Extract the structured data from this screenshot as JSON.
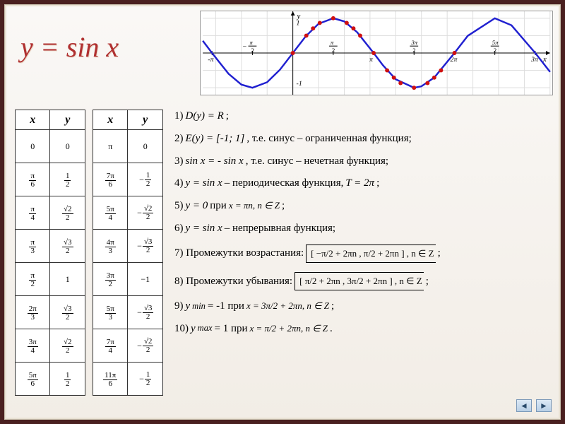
{
  "title": "y = sin x",
  "chart_data": {
    "type": "line",
    "title": "",
    "xlabel": "x",
    "ylabel": "y",
    "xlim": [
      -3.5,
      10
    ],
    "ylim": [
      -1.2,
      1.2
    ],
    "x_ticks": [
      {
        "value": -3.1416,
        "label": "-π"
      },
      {
        "value": -1.5708,
        "label": "−π/2"
      },
      {
        "value": 1.5708,
        "label": "π/2"
      },
      {
        "value": 3.1416,
        "label": "π"
      },
      {
        "value": 4.7124,
        "label": "3π/2"
      },
      {
        "value": 6.2832,
        "label": "2π"
      },
      {
        "value": 7.854,
        "label": "5π/2"
      },
      {
        "value": 9.4248,
        "label": "3π"
      }
    ],
    "y_ticks": [
      {
        "value": 1,
        "label": "1"
      },
      {
        "value": -1,
        "label": "-1"
      }
    ],
    "series": [
      {
        "name": "sin x",
        "color": "#2020d0",
        "x": [
          -3.5,
          -3.1416,
          -2.5,
          -2,
          -1.5708,
          -1,
          -0.5,
          0,
          0.5,
          1,
          1.5708,
          2,
          2.5,
          3.1416,
          3.5,
          4,
          4.7124,
          5,
          5.5,
          6.2832,
          6.8,
          7.854,
          8.5,
          9.4248,
          10
        ],
        "y": [
          0.3508,
          0,
          -0.5985,
          -0.9093,
          -1,
          -0.8415,
          -0.4794,
          0,
          0.4794,
          0.8415,
          1,
          0.9093,
          0.5985,
          0,
          -0.3508,
          -0.7568,
          -1,
          -0.9589,
          -0.7055,
          0,
          0.4941,
          1,
          0.798,
          0,
          -0.544
        ]
      }
    ],
    "points": {
      "color": "#d01010",
      "x": [
        0,
        0.5236,
        0.7854,
        1.0472,
        1.5708,
        2.0944,
        2.3562,
        2.618,
        3.1416,
        3.6652,
        3.927,
        4.1888,
        4.7124,
        5.236,
        5.4978,
        5.7596,
        6.2832
      ],
      "y": [
        0,
        0.5,
        0.7071,
        0.866,
        1,
        0.866,
        0.7071,
        0.5,
        0,
        -0.5,
        -0.7071,
        -0.866,
        -1,
        -0.866,
        -0.7071,
        -0.5,
        0
      ]
    }
  },
  "table1": {
    "headers": [
      "x",
      "y"
    ],
    "rows": [
      {
        "x": "0",
        "y": "0"
      },
      {
        "x": "π/6",
        "y": "1/2"
      },
      {
        "x": "π/4",
        "y": "√2/2"
      },
      {
        "x": "π/3",
        "y": "√3/2"
      },
      {
        "x": "π/2",
        "y": "1"
      },
      {
        "x": "2π/3",
        "y": "√3/2"
      },
      {
        "x": "3π/4",
        "y": "√2/2"
      },
      {
        "x": "5π/6",
        "y": "1/2"
      }
    ]
  },
  "table2": {
    "headers": [
      "x",
      "y"
    ],
    "rows": [
      {
        "x": "π",
        "y": "0"
      },
      {
        "x": "7π/6",
        "y": "−1/2"
      },
      {
        "x": "5π/4",
        "y": "−√2/2"
      },
      {
        "x": "4π/3",
        "y": "−√3/2"
      },
      {
        "x": "3π/2",
        "y": "-1"
      },
      {
        "x": "5π/3",
        "y": "−√3/2"
      },
      {
        "x": "7π/4",
        "y": "−√2/2"
      },
      {
        "x": "11π/6",
        "y": "−1/2"
      }
    ]
  },
  "props": {
    "p1": {
      "lead": "1) ",
      "math": "D(y) = R",
      "tail": ";"
    },
    "p2": {
      "lead": "2) ",
      "math": "E(y) = [-1; 1]",
      "tail": ", т.е. синус – ограниченная функция;"
    },
    "p3": {
      "lead": "3) ",
      "math": "sin x = - sin x",
      "tail": ", т.е. синус – нечетная функция;"
    },
    "p4": {
      "lead": "4) ",
      "math": "y = sin x",
      "mid": " – периодическая функция, ",
      "math2": "T = 2π",
      "tail": ";"
    },
    "p5": {
      "lead": "5) ",
      "math": "y = 0",
      "mid": " при ",
      "math2": "x = πn, n ∈ Z",
      "tail": ";"
    },
    "p6": {
      "lead": "6) ",
      "math": "y = sin x",
      "tail": " – непрерывная функция;"
    },
    "p7": {
      "lead": "7) Промежутки возрастания: ",
      "interval": "[ −π/2 + 2πn ,  π/2 + 2πn ] , n ∈ Z",
      "tail": " ;"
    },
    "p8": {
      "lead": "8) Промежутки убывания: ",
      "interval": "[  π/2 + 2πn ,  3π/2 + 2πn ] , n ∈ Z",
      "tail": " ;"
    },
    "p9": {
      "lead": "9) ",
      "math": "y",
      "sub": "min",
      "mid": "= -1 при  ",
      "cond": "x = 3π/2 + 2πn, n ∈ Z",
      "tail": " ;"
    },
    "p10": {
      "lead": "10) ",
      "math": "y",
      "sub": "max",
      "mid": "= 1 при  ",
      "cond": "x = π/2 + 2πn, n ∈ Z",
      "tail": " ."
    }
  },
  "nav": {
    "prev": "◄",
    "next": "►"
  }
}
